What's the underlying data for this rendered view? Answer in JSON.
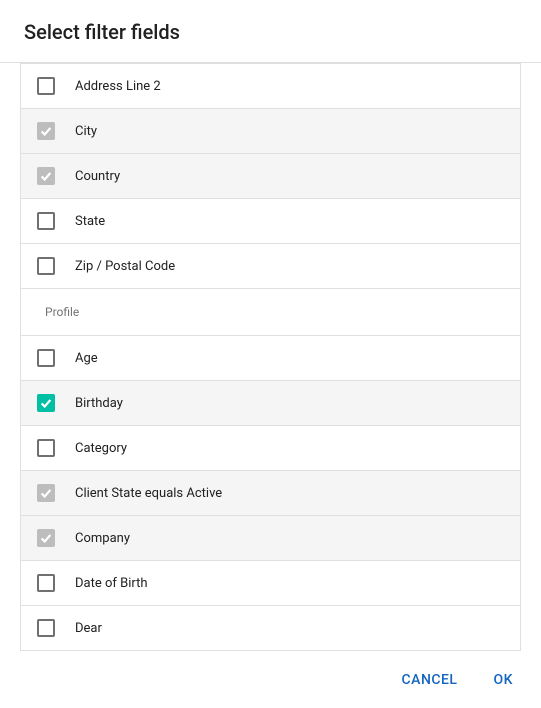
{
  "header": {
    "title": "Select filter fields"
  },
  "groups": [
    {
      "name": null,
      "items": [
        {
          "label": "Address Line 2",
          "checked": false,
          "disabled": false
        },
        {
          "label": "City",
          "checked": true,
          "disabled": true
        },
        {
          "label": "Country",
          "checked": true,
          "disabled": true
        },
        {
          "label": "State",
          "checked": false,
          "disabled": false
        },
        {
          "label": "Zip / Postal Code",
          "checked": false,
          "disabled": false
        }
      ]
    },
    {
      "name": "Profile",
      "items": [
        {
          "label": "Age",
          "checked": false,
          "disabled": false
        },
        {
          "label": "Birthday",
          "checked": true,
          "disabled": false
        },
        {
          "label": "Category",
          "checked": false,
          "disabled": false
        },
        {
          "label": "Client State equals Active",
          "checked": true,
          "disabled": true
        },
        {
          "label": "Company",
          "checked": true,
          "disabled": true
        },
        {
          "label": "Date of Birth",
          "checked": false,
          "disabled": false
        },
        {
          "label": "Dear",
          "checked": false,
          "disabled": false
        }
      ]
    }
  ],
  "footer": {
    "cancel": "CANCEL",
    "ok": "OK"
  }
}
